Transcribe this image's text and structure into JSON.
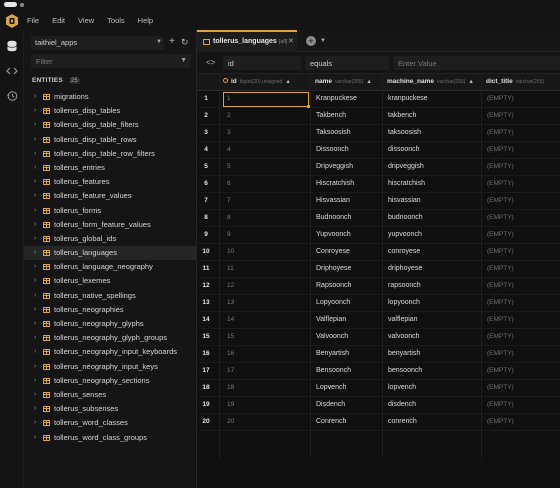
{
  "menu": [
    "File",
    "Edit",
    "View",
    "Tools",
    "Help"
  ],
  "colors": {
    "accent": "#d9a441",
    "background": "#0f0f0f",
    "sidebar": "#151515"
  },
  "sidebar": {
    "connection": "taithiel_apps",
    "filter_placeholder": "Filter",
    "entities_label": "ENTITIES",
    "entities_count": "25",
    "items": [
      "migrations",
      "tollerus_disp_tables",
      "tollerus_disp_table_filters",
      "tollerus_disp_table_rows",
      "tollerus_disp_table_row_filters",
      "tollerus_entries",
      "tollerus_features",
      "tollerus_feature_values",
      "tollerus_forms",
      "tollerus_form_feature_values",
      "tollerus_global_ids",
      "tollerus_languages",
      "tollerus_language_neography",
      "tollerus_lexemes",
      "tollerus_native_spellings",
      "tollerus_neographies",
      "tollerus_neography_glyphs",
      "tollerus_neography_glyph_groups",
      "tollerus_neography_input_keyboards",
      "tollerus_neography_input_keys",
      "tollerus_neography_sections",
      "tollerus_senses",
      "tollerus_subsenses",
      "tollerus_word_classes",
      "tollerus_word_class_groups"
    ],
    "active_index": 11
  },
  "tab": {
    "name": "tollerus_languages",
    "db": "[all]"
  },
  "filterbar": {
    "field": "id",
    "operator": "equals",
    "value_placeholder": "Enter Value"
  },
  "columns": {
    "id": {
      "label": "id",
      "type": "bigint(20) unsigned"
    },
    "name": {
      "label": "name",
      "type": "varchar(255)"
    },
    "machine_name": {
      "label": "machine_name",
      "type": "varchar(255)"
    },
    "dict_title": {
      "label": "dict_title",
      "type": "varchar(255)"
    }
  },
  "rows": [
    {
      "n": "1",
      "id": "1",
      "name": "Kranpuckese",
      "machine_name": "kranpuckese",
      "dict_title": "(EMPTY)"
    },
    {
      "n": "2",
      "id": "2",
      "name": "Takbench",
      "machine_name": "takbench",
      "dict_title": "(EMPTY)"
    },
    {
      "n": "3",
      "id": "3",
      "name": "Taksoosish",
      "machine_name": "taksoosish",
      "dict_title": "(EMPTY)"
    },
    {
      "n": "4",
      "id": "4",
      "name": "Dissoonch",
      "machine_name": "dissoonch",
      "dict_title": "(EMPTY)"
    },
    {
      "n": "5",
      "id": "5",
      "name": "Dripveggish",
      "machine_name": "dripveggish",
      "dict_title": "(EMPTY)"
    },
    {
      "n": "6",
      "id": "6",
      "name": "Hiscratchish",
      "machine_name": "hiscratchish",
      "dict_title": "(EMPTY)"
    },
    {
      "n": "7",
      "id": "7",
      "name": "Hisvassian",
      "machine_name": "hisvassian",
      "dict_title": "(EMPTY)"
    },
    {
      "n": "8",
      "id": "8",
      "name": "Budnoonch",
      "machine_name": "budnoonch",
      "dict_title": "(EMPTY)"
    },
    {
      "n": "9",
      "id": "9",
      "name": "Yupvoonch",
      "machine_name": "yupvoonch",
      "dict_title": "(EMPTY)"
    },
    {
      "n": "10",
      "id": "10",
      "name": "Conroyese",
      "machine_name": "conroyese",
      "dict_title": "(EMPTY)"
    },
    {
      "n": "11",
      "id": "11",
      "name": "Driphoyese",
      "machine_name": "driphoyese",
      "dict_title": "(EMPTY)"
    },
    {
      "n": "12",
      "id": "12",
      "name": "Rapsoonch",
      "machine_name": "rapsoonch",
      "dict_title": "(EMPTY)"
    },
    {
      "n": "13",
      "id": "13",
      "name": "Lopyoonch",
      "machine_name": "lopyoonch",
      "dict_title": "(EMPTY)"
    },
    {
      "n": "14",
      "id": "14",
      "name": "Valflepian",
      "machine_name": "valflepian",
      "dict_title": "(EMPTY)"
    },
    {
      "n": "15",
      "id": "15",
      "name": "Valvoonch",
      "machine_name": "valvoonch",
      "dict_title": "(EMPTY)"
    },
    {
      "n": "16",
      "id": "16",
      "name": "Benyartish",
      "machine_name": "benyartish",
      "dict_title": "(EMPTY)"
    },
    {
      "n": "17",
      "id": "17",
      "name": "Bensoonch",
      "machine_name": "bensoonch",
      "dict_title": "(EMPTY)"
    },
    {
      "n": "18",
      "id": "18",
      "name": "Lopvench",
      "machine_name": "lopvench",
      "dict_title": "(EMPTY)"
    },
    {
      "n": "19",
      "id": "19",
      "name": "Disdench",
      "machine_name": "disdench",
      "dict_title": "(EMPTY)"
    },
    {
      "n": "20",
      "id": "20",
      "name": "Conrench",
      "machine_name": "conrench",
      "dict_title": "(EMPTY)"
    }
  ]
}
